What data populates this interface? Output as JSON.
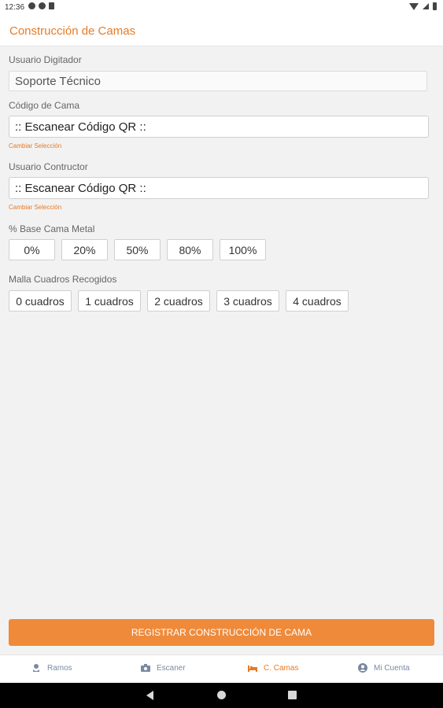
{
  "status": {
    "time": "12:36"
  },
  "header": {
    "title": "Construcción de Camas"
  },
  "form": {
    "usuario_digitador": {
      "label": "Usuario Digitador",
      "value": "Soporte Técnico"
    },
    "codigo_cama": {
      "label": "Código de Cama",
      "value": ":: Escanear Código QR ::",
      "change_label": "Cambiar Selección"
    },
    "usuario_constructor": {
      "label": "Usuario Contructor",
      "value": ":: Escanear Código QR ::",
      "change_label": "Cambiar Selección"
    },
    "base_cama": {
      "label": "% Base Cama Metal",
      "options": [
        "0%",
        "20%",
        "50%",
        "80%",
        "100%"
      ]
    },
    "malla": {
      "label": "Malla Cuadros Recogidos",
      "options": [
        "0 cuadros",
        "1 cuadros",
        "2 cuadros",
        "3 cuadros",
        "4 cuadros"
      ]
    },
    "submit_label": "REGISTRAR CONSTRUCCIÓN DE CAMA"
  },
  "nav": {
    "items": [
      {
        "label": "Ramos",
        "icon": "flower-icon"
      },
      {
        "label": "Escaner",
        "icon": "camera-icon"
      },
      {
        "label": "C. Camas",
        "icon": "bed-icon",
        "active": true
      },
      {
        "label": "Mi Cuenta",
        "icon": "account-icon"
      }
    ]
  },
  "colors": {
    "accent": "#e87a24",
    "button": "#ef8a3a",
    "nav_inactive": "#7a8aa0"
  }
}
